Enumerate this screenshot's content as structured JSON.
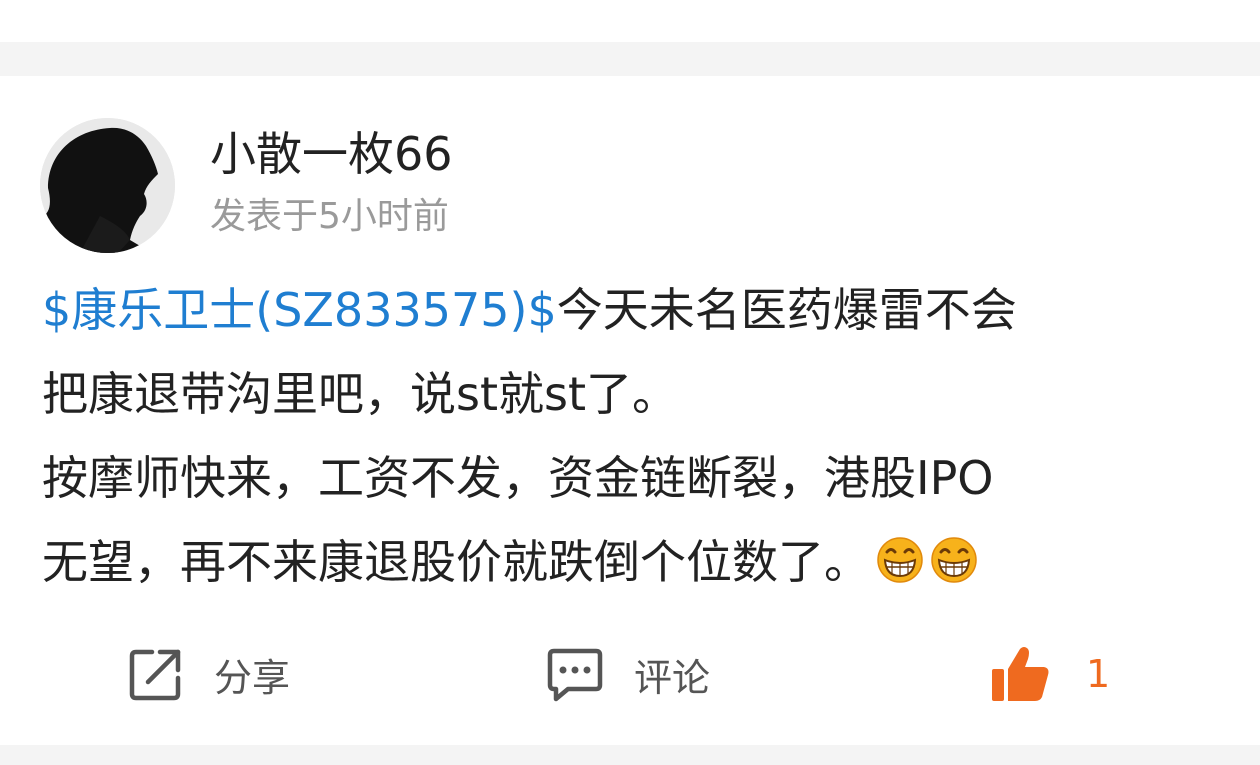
{
  "post": {
    "author": {
      "name": "小散一枚66",
      "time": "发表于5小时前"
    },
    "content": {
      "stock_tag": "$康乐卫士(SZ833575)$",
      "line1_rest": "今天未名医药爆雷不会",
      "line2": "把康退带沟里吧，说st就st了。",
      "line3": "按摩师快来，工资不发，资金链断裂，港股IPO",
      "line4": "无望，再不来康退股价就跌倒个位数了。"
    },
    "emojis": [
      "grin-emoji",
      "grin-emoji"
    ],
    "actions": {
      "share_label": "分享",
      "comment_label": "评论",
      "like_count": "1"
    }
  },
  "colors": {
    "link": "#1f7ed1",
    "like": "#ef6a1f",
    "muted": "#9a9a9a",
    "text": "#222222"
  }
}
